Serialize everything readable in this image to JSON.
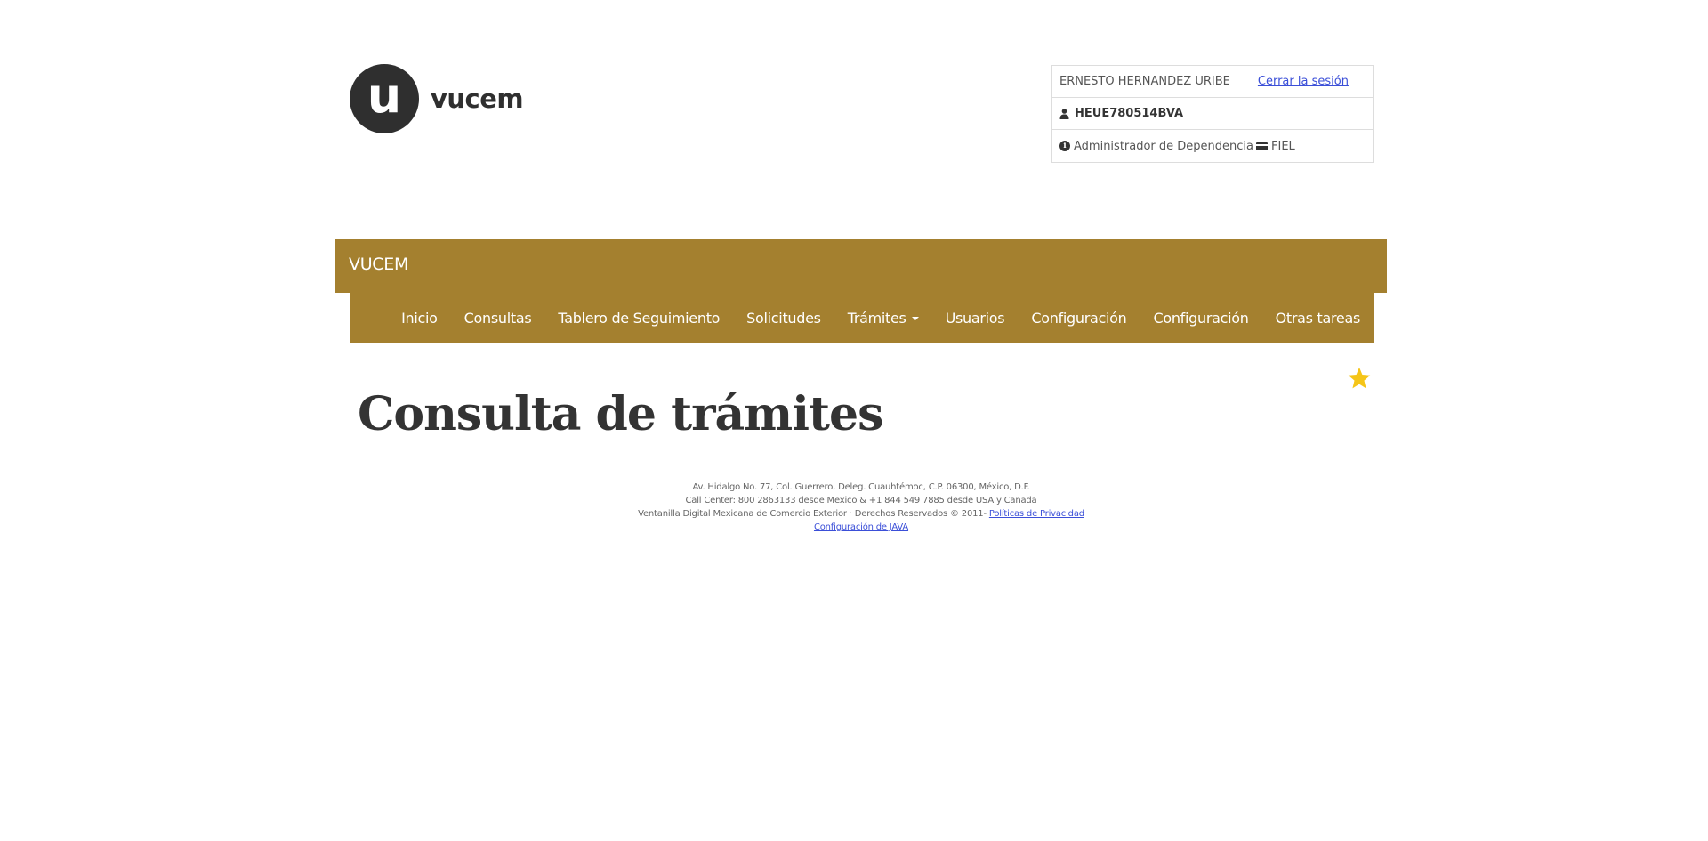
{
  "logo": {
    "mark": "u",
    "text": "vucem"
  },
  "user": {
    "name": "ERNESTO HERNANDEZ URIBE",
    "logout_label": "Cerrar la sesión",
    "rfc": "HEUE780514BVA",
    "role": "Administrador de Dependencia",
    "auth": "FIEL",
    "icons": {
      "user": "user-icon",
      "role": "info-icon",
      "auth": "credit-card-icon"
    }
  },
  "topbar": {
    "brand": "VUCEM",
    "color": "#a4802f"
  },
  "nav": {
    "items": [
      {
        "label": "Inicio"
      },
      {
        "label": "Consultas"
      },
      {
        "label": "Tablero de Seguimiento"
      },
      {
        "label": "Solicitudes"
      },
      {
        "label": "Trámites"
      },
      {
        "label": "Usuarios"
      },
      {
        "label": "Configuración"
      },
      {
        "label": "Configuración"
      },
      {
        "label": "Otras tareas"
      }
    ]
  },
  "main": {
    "title": "Consulta de trámites",
    "favorite_icon": "star-icon",
    "star_color": "#f5c518"
  },
  "footer": {
    "address": "Av. Hidalgo No. 77, Col. Guerrero, Deleg. Cuauhtémoc, C.P. 06300, México, D.F.",
    "call_center": "Call Center: 800 2863133 desde Mexico & +1 844 549 7885 desde USA y Canada",
    "rights": "Ventanilla Digital Mexicana de Comercio Exterior · Derechos Reservados © 2011-",
    "privacy_link": "Políticas de Privacidad",
    "java_link": "Configuración de JAVA"
  }
}
